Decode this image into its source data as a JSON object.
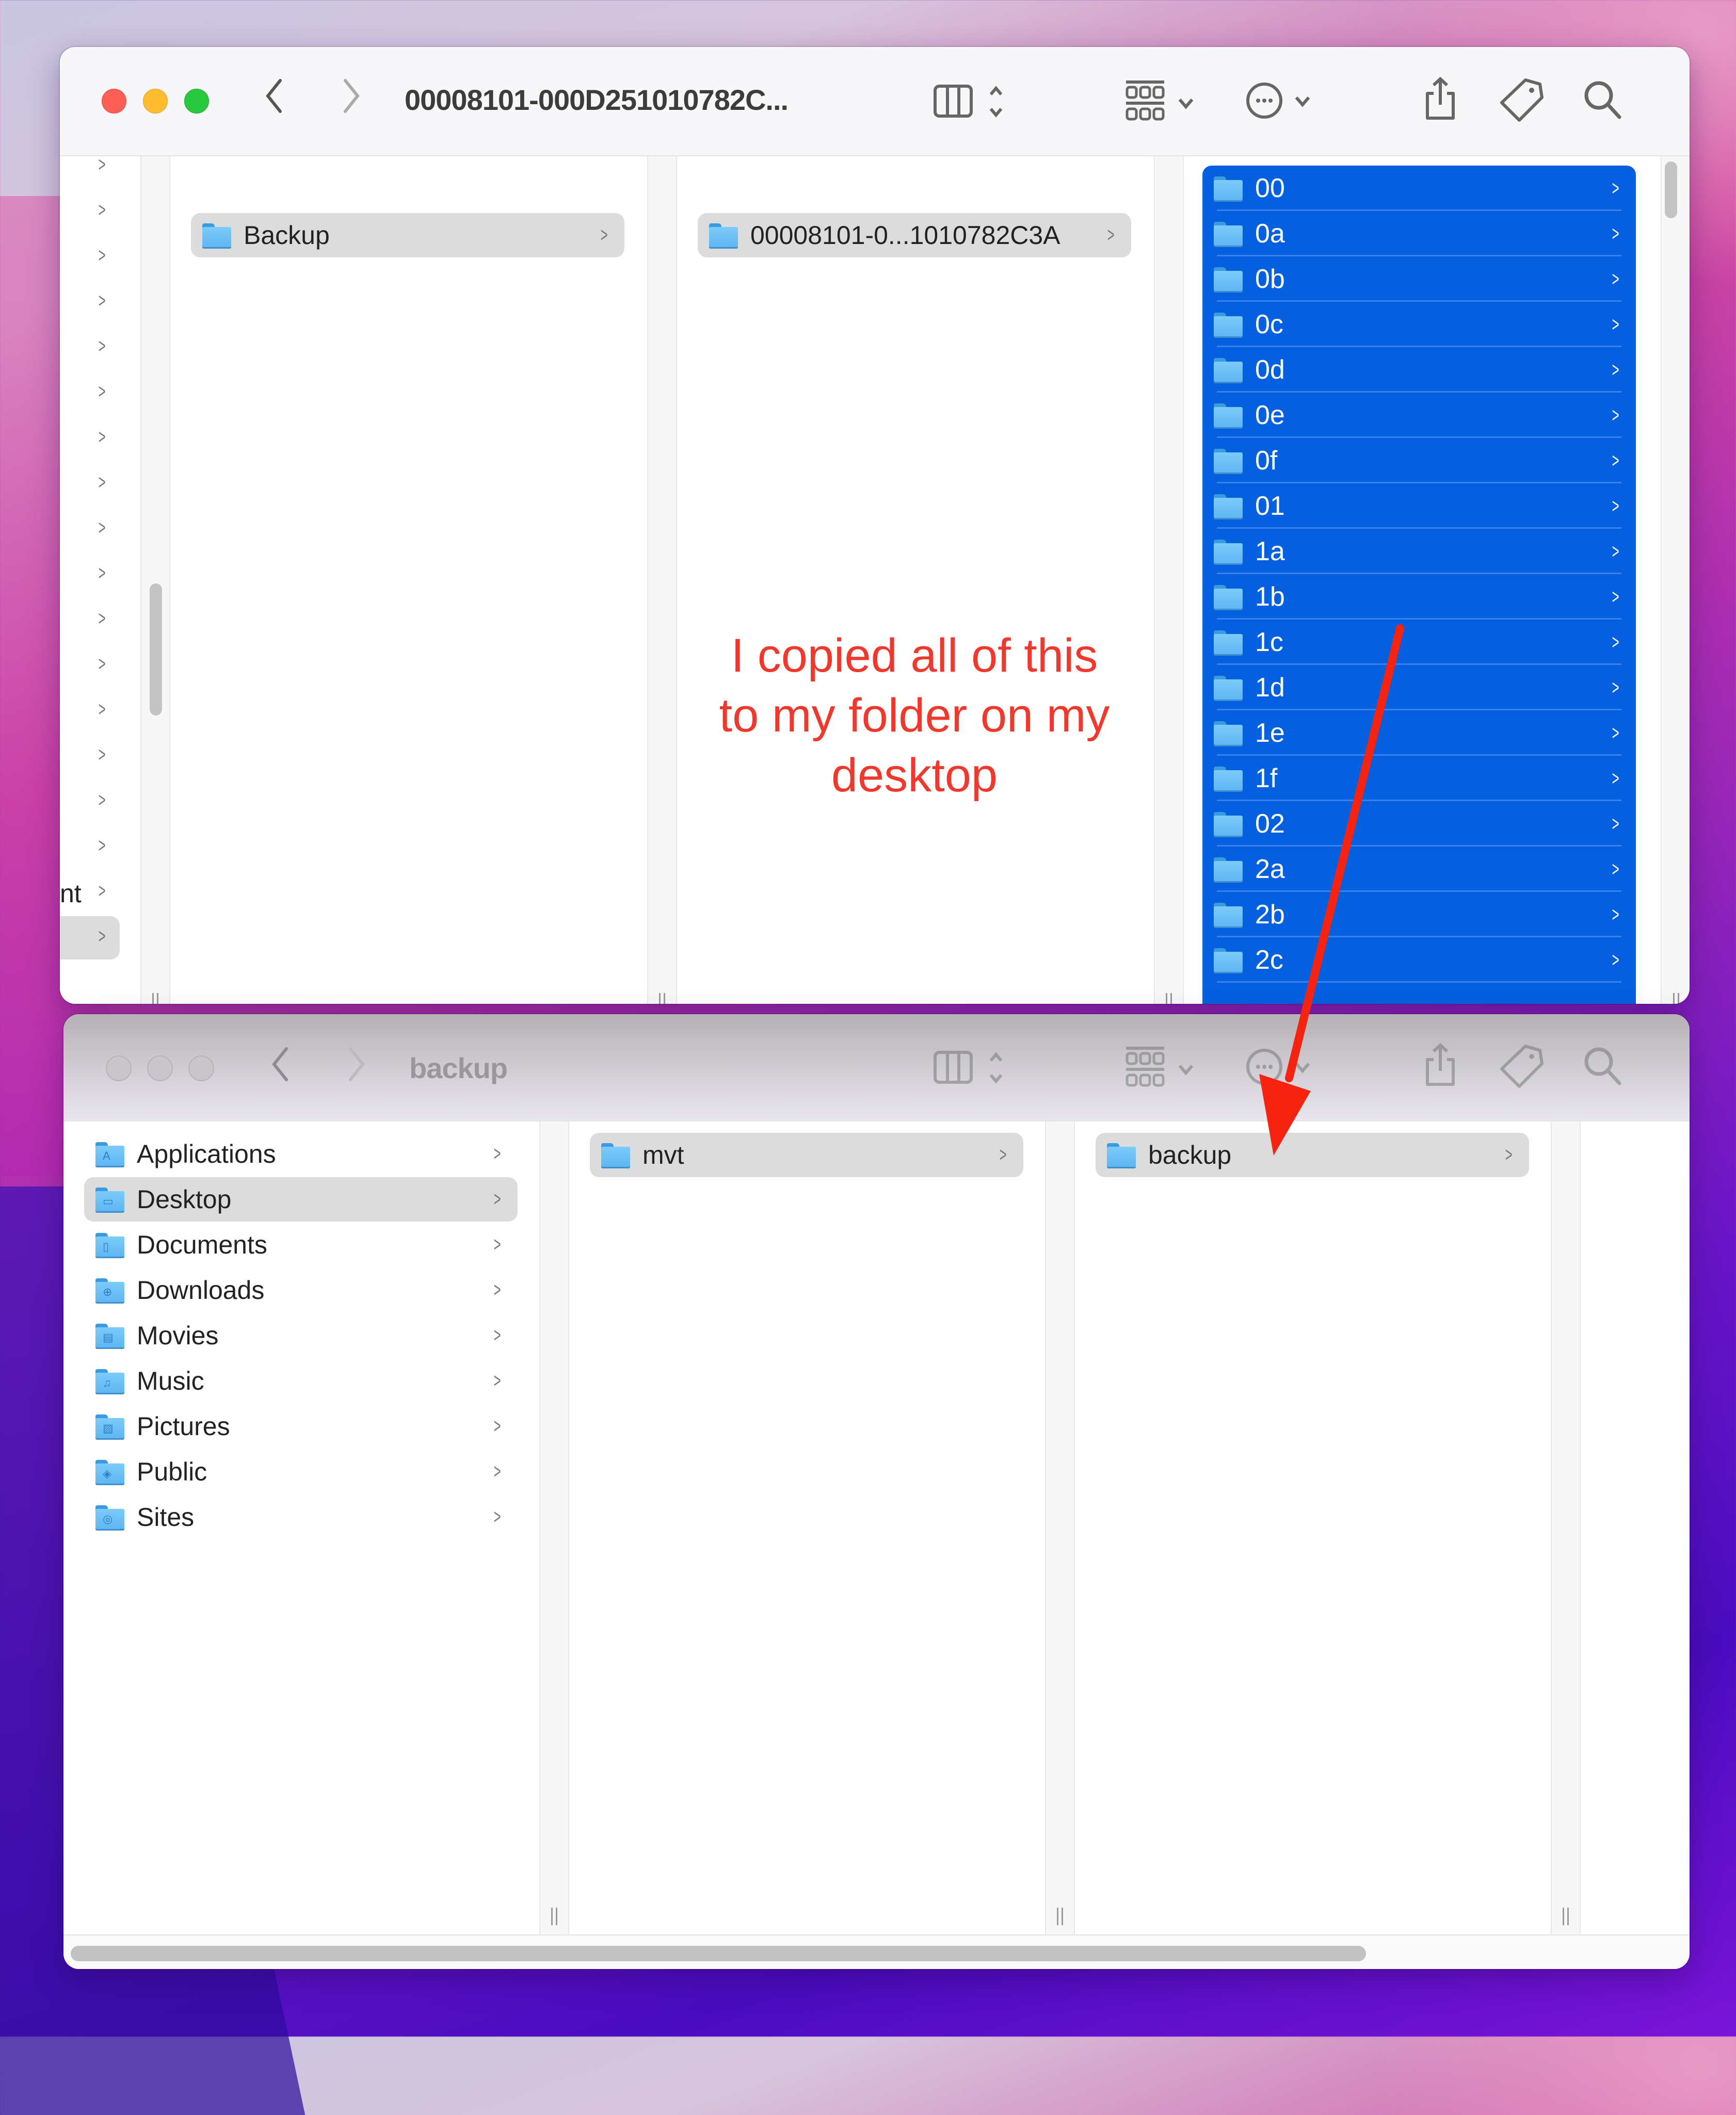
{
  "desktop": {
    "accent_colors": {
      "selection_blue": "#0560E0",
      "annotation_red": "#F0382D"
    }
  },
  "top_window": {
    "title": "00008101-000D251010782C...",
    "state": "active",
    "toolbar": {
      "back_icon": "chevron-left-icon",
      "forward_icon": "chevron-right-icon",
      "view_icon": "column-view-icon",
      "group_icon": "group-grid-icon",
      "action_icon": "ellipsis-circle-icon",
      "share_icon": "share-icon",
      "tag_icon": "tag-icon",
      "search_icon": "search-icon"
    },
    "sidebar_partial": {
      "visible_text": "nt"
    },
    "columns": [
      {
        "items": [
          {
            "name": "Backup",
            "state": "selected-inactive"
          }
        ]
      },
      {
        "items": [
          {
            "name": "00008101-0...1010782C3A",
            "state": "selected-inactive"
          }
        ]
      },
      {
        "items": [
          {
            "name": "00"
          },
          {
            "name": "0a"
          },
          {
            "name": "0b"
          },
          {
            "name": "0c"
          },
          {
            "name": "0d"
          },
          {
            "name": "0e"
          },
          {
            "name": "0f"
          },
          {
            "name": "01"
          },
          {
            "name": "1a"
          },
          {
            "name": "1b"
          },
          {
            "name": "1c"
          },
          {
            "name": "1d"
          },
          {
            "name": "1e"
          },
          {
            "name": "1f"
          },
          {
            "name": "02"
          },
          {
            "name": "2a"
          },
          {
            "name": "2b"
          },
          {
            "name": "2c"
          }
        ],
        "state": "all-selected"
      }
    ]
  },
  "annotation": {
    "text_lines": [
      "I copied all of this",
      "to my folder on my",
      "desktop"
    ],
    "arrow": "points from selected folders to backup folder in lower window"
  },
  "bottom_window": {
    "title": "backup",
    "state": "inactive",
    "sidebar": {
      "items": [
        {
          "name": "Applications",
          "icon": "applications-folder-icon",
          "glyph": "A"
        },
        {
          "name": "Desktop",
          "icon": "desktop-folder-icon",
          "glyph": "▭",
          "selected": true
        },
        {
          "name": "Documents",
          "icon": "documents-folder-icon",
          "glyph": "▯"
        },
        {
          "name": "Downloads",
          "icon": "downloads-folder-icon",
          "glyph": "⊕"
        },
        {
          "name": "Movies",
          "icon": "movies-folder-icon",
          "glyph": "▤"
        },
        {
          "name": "Music",
          "icon": "music-folder-icon",
          "glyph": "♫"
        },
        {
          "name": "Pictures",
          "icon": "pictures-folder-icon",
          "glyph": "▨"
        },
        {
          "name": "Public",
          "icon": "public-folder-icon",
          "glyph": "◈"
        },
        {
          "name": "Sites",
          "icon": "sites-folder-icon",
          "glyph": "◎"
        }
      ]
    },
    "columns": [
      {
        "items": [
          {
            "name": "mvt",
            "state": "selected-inactive"
          }
        ]
      },
      {
        "items": [
          {
            "name": "backup",
            "state": "selected-inactive"
          }
        ]
      }
    ]
  }
}
